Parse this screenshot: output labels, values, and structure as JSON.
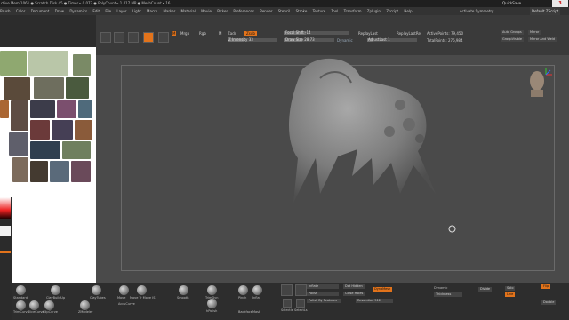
{
  "titlebar": {
    "text": "ctive Mem 1061 ● Scratch Disk 45 ● Timer ▸ 0.077 ● PolyCount ▸ 1.417 MP ● MeshCount ▸ 16",
    "quicksave": "QuickSave",
    "badge": "3"
  },
  "menubar": {
    "items": [
      "Brush",
      "Color",
      "Document",
      "Draw",
      "Dynamics",
      "Edit",
      "File",
      "Layer",
      "Light",
      "Macro",
      "Marker",
      "Material",
      "Movie",
      "Picker",
      "Preferences",
      "Render",
      "Stencil",
      "Stroke",
      "Texture",
      "Tool",
      "Transform",
      "Zplugin",
      "Zscript",
      "Help"
    ],
    "activate_symmetry": "Activate Symmetry",
    "right_button": "Default ZScript"
  },
  "toolbar": {
    "mrgb": "M",
    "rgb": "Rgb",
    "m": "M",
    "zadd": "Zadd",
    "zsub": "Zsub",
    "mrgb_label": "Mrgb",
    "z_intensity": "Z Intensity 33",
    "focal_shift": "Focal Shift -14",
    "draw_size": "Draw Size 28.73",
    "dynamic": "Dynamic",
    "replay_last": "ReplayLast",
    "replay_last_rel": "ReplayLastRel",
    "adjust_last": "AdjustLast 1",
    "active_points": "ActivePoints: 79,450",
    "total_points": "TotalPoints: 276,984",
    "auto_groups": "Auto Groups",
    "group_visible": "GroupVisible",
    "mirror": "Mirror",
    "mirror_and_weld": "Mirror And Weld",
    "icons": [
      "edit-icon",
      "draw-icon",
      "move-icon",
      "scale-icon",
      "rotate-icon"
    ]
  },
  "bottom": {
    "brushes": [
      "Standard",
      "ClayBuildUp",
      "ClayTubes",
      "Move",
      "Move Topological",
      "hPolish",
      "TrimDynamic",
      "Pinch",
      "Inflat",
      "ZModeler",
      "Smooth",
      "Flatten"
    ],
    "labels": {
      "standard": "Standard",
      "claybuildup": "ClayBuildUp",
      "claytubes": "ClayTubes",
      "move": "Move",
      "move_infinite": "Move Tr Move IS",
      "accucurve": "AccuCurve",
      "smooth": "Smooth",
      "trimdyn": "TrimDyn",
      "pinch": "Pinch",
      "inflat": "Inflat",
      "hpolish": "hPolish",
      "backface": "BackfaceMask",
      "trimcurve": "TrimCurve",
      "slicecurve": "SliceCurve",
      "clipcurve": "ClipCurve",
      "zmodeler": "ZModeler",
      "selectrect": "SelectRect",
      "selectlasso": "Selectle SelectLs",
      "inflate": "Inflate",
      "polish": "Polish",
      "polish_features": "Polish By Features",
      "dot_hidden": "Dot Hidden",
      "close_holes": "Close Holes",
      "dynamesh": "DynaMesh",
      "resolution": "Resolution 512",
      "dynamic": "Dynamic",
      "thickness": "Thickness",
      "divide": "Divide",
      "solo": "Solo",
      "line": "Line",
      "double": "Double",
      "flip": "Flip"
    }
  },
  "colors": {
    "accent": "#e2731b",
    "canvas": "#4a4a4a",
    "panel": "#3a3a3a",
    "model": "#8a8a8a"
  }
}
